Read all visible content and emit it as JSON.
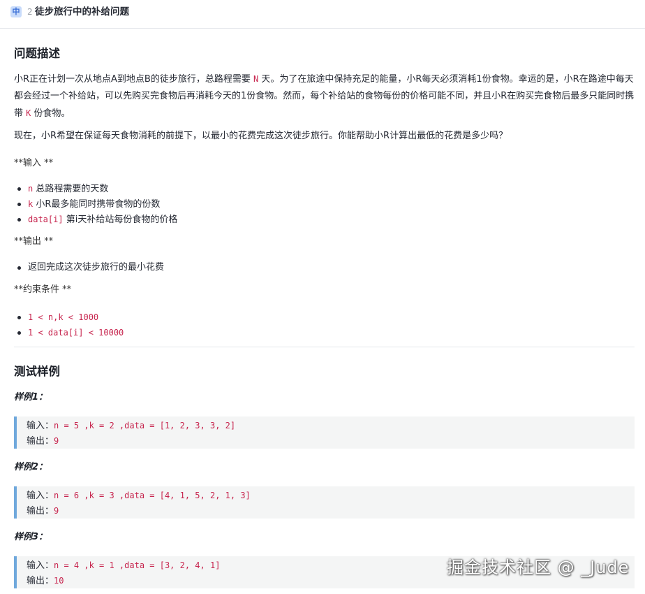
{
  "header": {
    "difficulty_badge": "中",
    "problem_number": "2",
    "title": "徒步旅行中的补给问题"
  },
  "description": {
    "heading": "问题描述",
    "p1_a": "小R正在计划一次从地点A到地点B的徒步旅行，总路程需要",
    "p1_n": "N",
    "p1_b": "天。为了在旅途中保持充足的能量，小R每天必须消耗1份食物。幸运的是，小R在路途中每天都会经过一个补给站，可以先购买完食物后再消耗今天的1份食物。然而，每个补给站的食物每份的价格可能不同，并且小R在购买完食物后最多只能同时携带",
    "p1_k": "K",
    "p1_c": "份食物。",
    "p2": "现在，小R希望在保证每天食物消耗的前提下，以最小的花费完成这次徒步旅行。你能帮助小R计算出最低的花费是多少吗？"
  },
  "input_section": {
    "label": "**输入 **",
    "items": [
      {
        "code": "n",
        "text": " 总路程需要的天数"
      },
      {
        "code": "k",
        "text": " 小R最多能同时携带食物的份数"
      },
      {
        "code": "data[i]",
        "text": " 第i天补给站每份食物的价格"
      }
    ]
  },
  "output_section": {
    "label": "**输出 **",
    "items": [
      "返回完成这次徒步旅行的最小花费"
    ]
  },
  "constraints_section": {
    "label": "**约束条件 **",
    "items": [
      "1 < n,k < 1000",
      "1 < data[i] < 10000"
    ]
  },
  "tests": {
    "heading": "测试样例",
    "samples": [
      {
        "label": "样例1：",
        "input_prefix": "输入：",
        "input_value": "n = 5 ,k = 2 ,data = [1, 2, 3, 3, 2]",
        "output_prefix": "输出：",
        "output_value": "9"
      },
      {
        "label": "样例2：",
        "input_prefix": "输入：",
        "input_value": "n = 6 ,k = 3 ,data = [4, 1, 5, 2, 1, 3]",
        "output_prefix": "输出：",
        "output_value": "9"
      },
      {
        "label": "样例3：",
        "input_prefix": "输入：",
        "input_value": "n = 4 ,k = 1 ,data = [3, 2, 4, 1]",
        "output_prefix": "输出：",
        "output_value": "10"
      }
    ]
  },
  "watermark": "掘金技术社区 @ _Jude"
}
